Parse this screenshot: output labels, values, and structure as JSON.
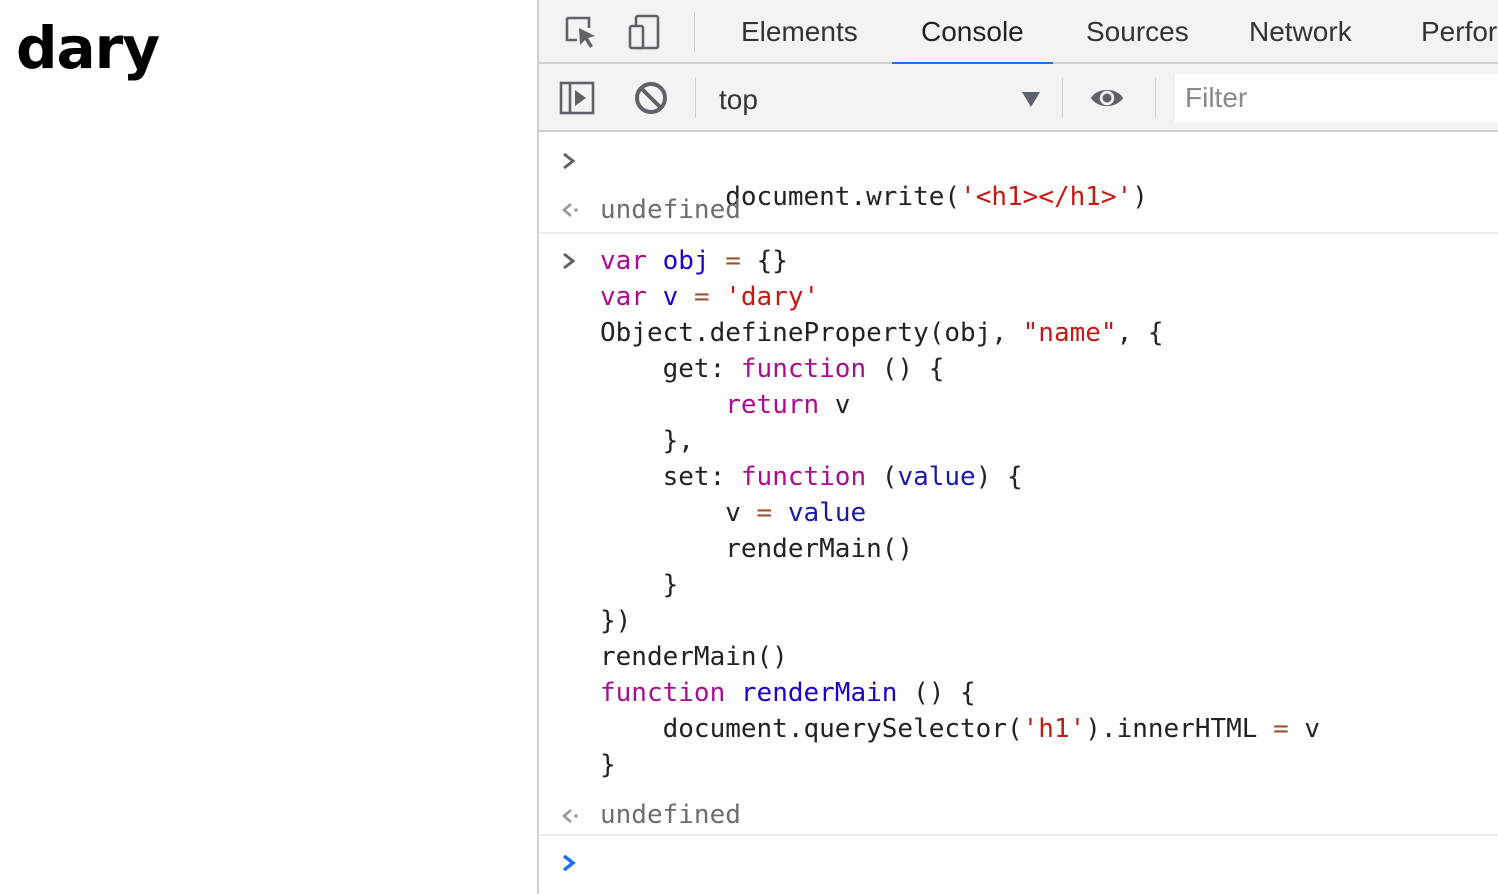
{
  "page": {
    "heading": "dary"
  },
  "devtools": {
    "tabs": [
      "Elements",
      "Console",
      "Sources",
      "Network",
      "Perfor"
    ],
    "active_tab": "Console",
    "toolbar": {
      "context": "top",
      "filter_placeholder": "Filter"
    },
    "console": {
      "cmd1": "document.write('<h1></h1>')",
      "result1": "undefined",
      "cmd2_lines": [
        "var obj = {}",
        "var v = 'dary'",
        "Object.defineProperty(obj, \"name\", {",
        "    get: function () {",
        "        return v",
        "    },",
        "    set: function (value) {",
        "        v = value",
        "        renderMain()",
        "    }",
        "})",
        "renderMain()",
        "function renderMain () {",
        "    document.querySelector('h1').innerHTML = v",
        "}"
      ],
      "result2": "undefined"
    },
    "colors": {
      "accent": "#1a73e8",
      "keyword": "#aa0d91",
      "string": "#c41a16",
      "variable": "#1c00cf"
    }
  }
}
